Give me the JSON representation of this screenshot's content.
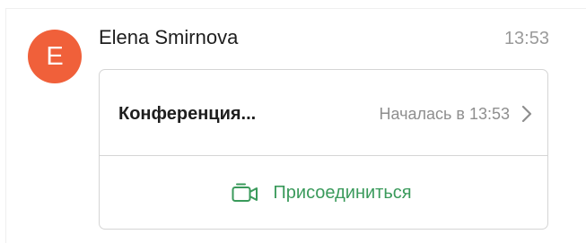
{
  "message": {
    "sender": {
      "name": "Elena Smirnova",
      "initial": "E",
      "avatar_color": "#f0603a"
    },
    "time": "13:53",
    "conference": {
      "title": "Конференция...",
      "status": "Началась в 13:53",
      "chevron_icon": "chevron-right-icon",
      "join_label": "Присоединиться",
      "join_icon": "video-camera-icon",
      "accent_color": "#3a9a5b"
    }
  }
}
